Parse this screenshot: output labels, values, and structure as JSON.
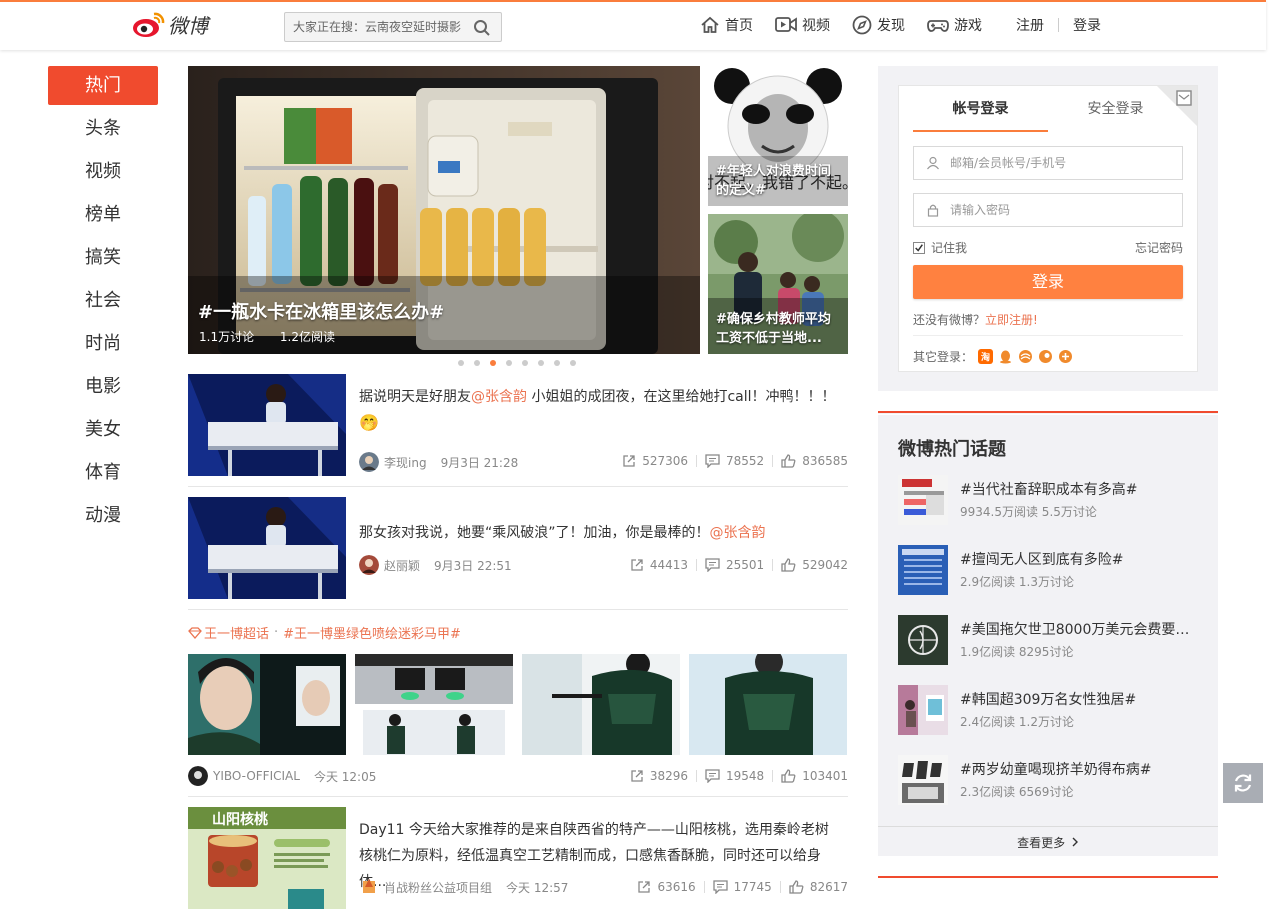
{
  "header": {
    "logo_text": "微博",
    "search_placeholder": "大家正在搜：云南夜空延时摄影",
    "nav": [
      "首页",
      "视频",
      "发现",
      "游戏"
    ],
    "register": "注册",
    "login": "登录"
  },
  "leftnav": [
    "热门",
    "头条",
    "视频",
    "榜单",
    "搞笑",
    "社会",
    "时尚",
    "电影",
    "美女",
    "体育",
    "动漫"
  ],
  "hero": {
    "title": "#一瓶水卡在冰箱里该怎么办#",
    "discuss": "1.1万讨论",
    "reads": "1.2亿阅读"
  },
  "side_cards": [
    {
      "caption": "#年轻人对浪费时间的定义#",
      "overlay_text": "对不起，我错了不起。"
    },
    {
      "caption": "#确保乡村教师平均工资不低于当地..."
    }
  ],
  "feed": [
    {
      "text_before": "据说明天是好朋友",
      "mention": "@张含韵",
      "text_after": " 小姐姐的成团夜，在这里给她打call！冲鸭！！！",
      "emoji": "🤭",
      "author": "李现ing",
      "time": "9月3日 21:28",
      "shares": "527306",
      "comments": "78552",
      "likes": "836585"
    },
    {
      "text_before": "那女孩对我说，她要“乘风破浪”了！加油，你是最棒的！",
      "mention": "@张含韵",
      "author": "赵丽颖",
      "time": "9月3日 22:51",
      "shares": "44413",
      "comments": "25501",
      "likes": "529042"
    }
  ],
  "super_topic": {
    "name": "王一博超话",
    "sep": "·",
    "tag": "#王一博墨绿色喷绘迷彩马甲#",
    "author": "YIBO-OFFICIAL",
    "time": "今天 12:05",
    "shares": "38296",
    "comments": "19548",
    "likes": "103401"
  },
  "feed_last": {
    "thumb_text": "山阳核桃",
    "text": "Day11 今天给大家推荐的是来自陕西省的特产——山阳核桃，选用秦岭老树核桃仁为原料，经低温真空工艺精制而成，口感焦香酥脆，同时还可以给身体...",
    "author": "肖战粉丝公益项目组",
    "time": "今天 12:57",
    "shares": "63616",
    "comments": "17745",
    "likes": "82617"
  },
  "login_panel": {
    "tab_account": "帐号登录",
    "tab_secure": "安全登录",
    "username_placeholder": "邮箱/会员帐号/手机号",
    "password_placeholder": "请输入密码",
    "remember": "记住我",
    "forgot": "忘记密码",
    "button": "登录",
    "no_account": "还没有微博？",
    "register_now": "立即注册!",
    "other_login": "其它登录："
  },
  "hot_topics": {
    "title": "微博热门话题",
    "items": [
      {
        "name": "#当代社畜辞职成本有多高#",
        "meta": "9934.5万阅读 5.5万讨论"
      },
      {
        "name": "#擅闯无人区到底有多险#",
        "meta": "2.9亿阅读 1.3万讨论"
      },
      {
        "name": "#美国拖欠世卫8000万美元会费要赖...",
        "meta": "1.9亿阅读 8295讨论"
      },
      {
        "name": "#韩国超309万名女性独居#",
        "meta": "2.4亿阅读 1.2万讨论"
      },
      {
        "name": "#两岁幼童喝现挤羊奶得布病#",
        "meta": "2.3亿阅读 6569讨论"
      }
    ],
    "more": "查看更多"
  },
  "colors": {
    "accent": "#fa7d3c",
    "active_nav": "#f04b2e",
    "mention": "#eb7350"
  }
}
